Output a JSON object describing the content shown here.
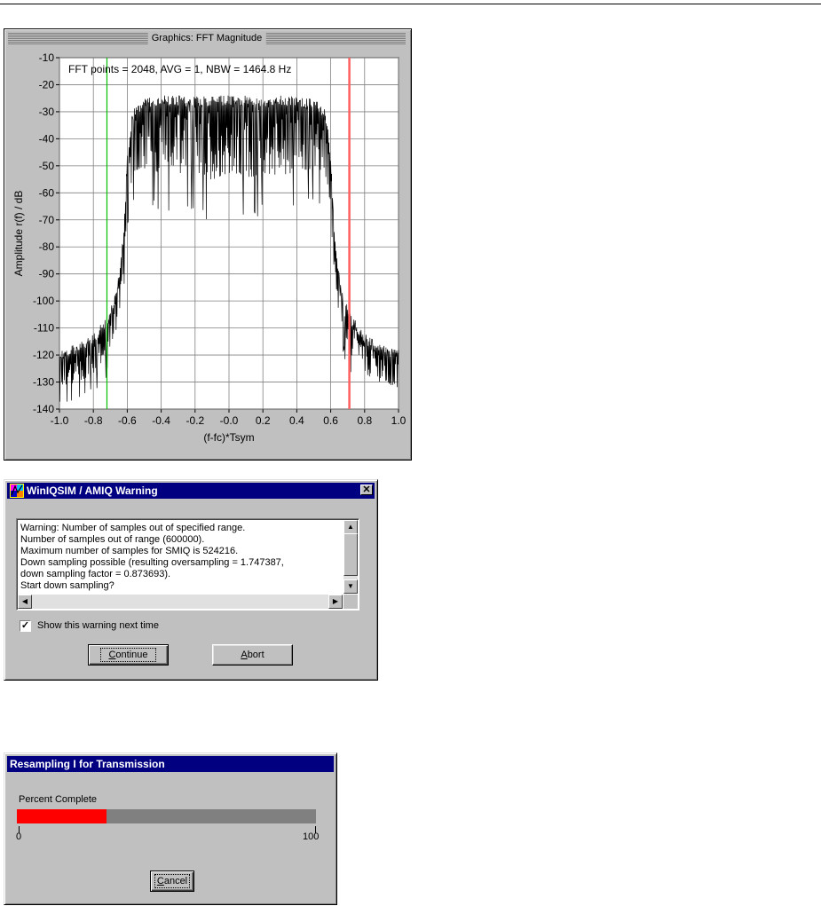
{
  "fft_window": {
    "title": "Graphics: FFT Magnitude"
  },
  "chart_data": {
    "type": "line",
    "annotation": "FFT points = 2048, AVG = 1, NBW = 1464.8 Hz",
    "xlabel": "(f-fc)*Tsym",
    "ylabel": "Amplitude r(f) / dB",
    "xlim": [
      -1.0,
      1.0
    ],
    "ylim": [
      -140,
      -10
    ],
    "x_ticks": [
      "-1.0",
      "-0.8",
      "-0.6",
      "-0.4",
      "-0.2",
      "-0.0",
      "0.2",
      "0.4",
      "0.6",
      "0.8",
      "1.0"
    ],
    "y_ticks": [
      "-10",
      "-20",
      "-30",
      "-40",
      "-50",
      "-60",
      "-70",
      "-80",
      "-90",
      "-100",
      "-110",
      "-120",
      "-130",
      "-140"
    ],
    "grid": true,
    "markers": [
      {
        "x": -0.72,
        "color": "#00c000"
      },
      {
        "x": 0.71,
        "color": "#ff6060"
      }
    ],
    "spectrum_envelope": {
      "x": [
        -1.0,
        -0.9,
        -0.8,
        -0.72,
        -0.66,
        -0.63,
        -0.61,
        -0.6,
        -0.58,
        -0.56,
        -0.5,
        -0.4,
        -0.3,
        -0.2,
        -0.1,
        0.0,
        0.1,
        0.2,
        0.3,
        0.4,
        0.5,
        0.56,
        0.58,
        0.6,
        0.61,
        0.63,
        0.66,
        0.72,
        0.8,
        0.9,
        1.0
      ],
      "upper": [
        -118,
        -116,
        -112,
        -105,
        -95,
        -80,
        -60,
        -45,
        -34,
        -28,
        -25,
        -24,
        -24,
        -24,
        -24,
        -24,
        -24,
        -24,
        -24,
        -24,
        -25,
        -28,
        -34,
        -45,
        -60,
        -80,
        -95,
        -105,
        -112,
        -116,
        -118
      ],
      "lower": [
        -140,
        -138,
        -135,
        -128,
        -118,
        -105,
        -90,
        -75,
        -70,
        -65,
        -65,
        -68,
        -70,
        -68,
        -72,
        -68,
        -72,
        -68,
        -70,
        -68,
        -65,
        -65,
        -70,
        -75,
        -90,
        -105,
        -118,
        -128,
        -135,
        -138,
        -140
      ]
    },
    "color": "#000000"
  },
  "warning_dialog": {
    "title": "WinIQSIM / AMIQ Warning",
    "close_glyph": "✕",
    "lines": [
      "Warning: Number of samples out of specified range.",
      "Number of samples out of range (600000).",
      "Maximum number of samples for SMIQ is 524216.",
      "Down sampling possible (resulting oversampling = 1.747387,",
      "down sampling factor = 0.873693).",
      "Start down sampling?"
    ],
    "checkbox_label": "Show this warning next time",
    "checkbox_checked": true,
    "check_glyph": "✓",
    "continue_first": "C",
    "continue_rest": "ontinue",
    "abort_first": "A",
    "abort_rest": "bort"
  },
  "progress_dialog": {
    "title": "Resampling I for Transmission",
    "label": "Percent Complete",
    "percent": 30,
    "min_label": "0",
    "max_label": "100",
    "cancel_first": "C",
    "cancel_rest": "ancel",
    "bar_color": "#ff0000"
  }
}
